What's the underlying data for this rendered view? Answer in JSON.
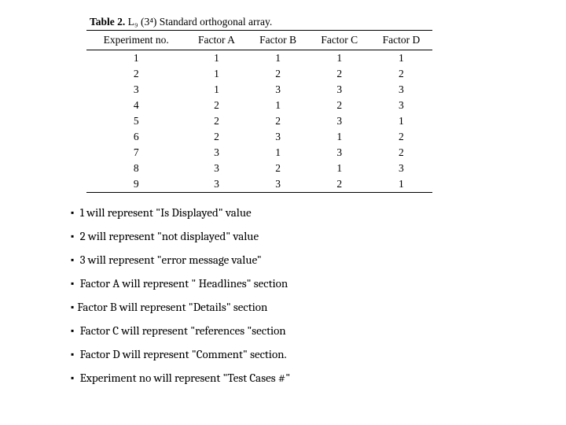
{
  "table": {
    "caption_bold": "Table 2.",
    "caption_rest": " L₉ (3⁴) Standard orthogonal array.",
    "headers": [
      "Experiment no.",
      "Factor A",
      "Factor B",
      "Factor C",
      "Factor D"
    ],
    "rows": [
      [
        "1",
        "1",
        "1",
        "1",
        "1"
      ],
      [
        "2",
        "1",
        "2",
        "2",
        "2"
      ],
      [
        "3",
        "1",
        "3",
        "3",
        "3"
      ],
      [
        "4",
        "2",
        "1",
        "2",
        "3"
      ],
      [
        "5",
        "2",
        "2",
        "3",
        "1"
      ],
      [
        "6",
        "2",
        "3",
        "1",
        "2"
      ],
      [
        "7",
        "3",
        "1",
        "3",
        "2"
      ],
      [
        "8",
        "3",
        "2",
        "1",
        "3"
      ],
      [
        "9",
        "3",
        "3",
        "2",
        "1"
      ]
    ]
  },
  "notes": [
    " 1 will represent \"Is Displayed\" value",
    " 2 will represent \"not displayed\" value",
    " 3 will represent \"error message value\"",
    " Factor A will represent \" Headlines\" section",
    "Factor B will represent \"Details\" section",
    " Factor C will represent \"references \"section",
    " Factor D will represent \"Comment\" section.",
    " Experiment no will represent \"Test Cases #\""
  ],
  "bullet": "▪"
}
